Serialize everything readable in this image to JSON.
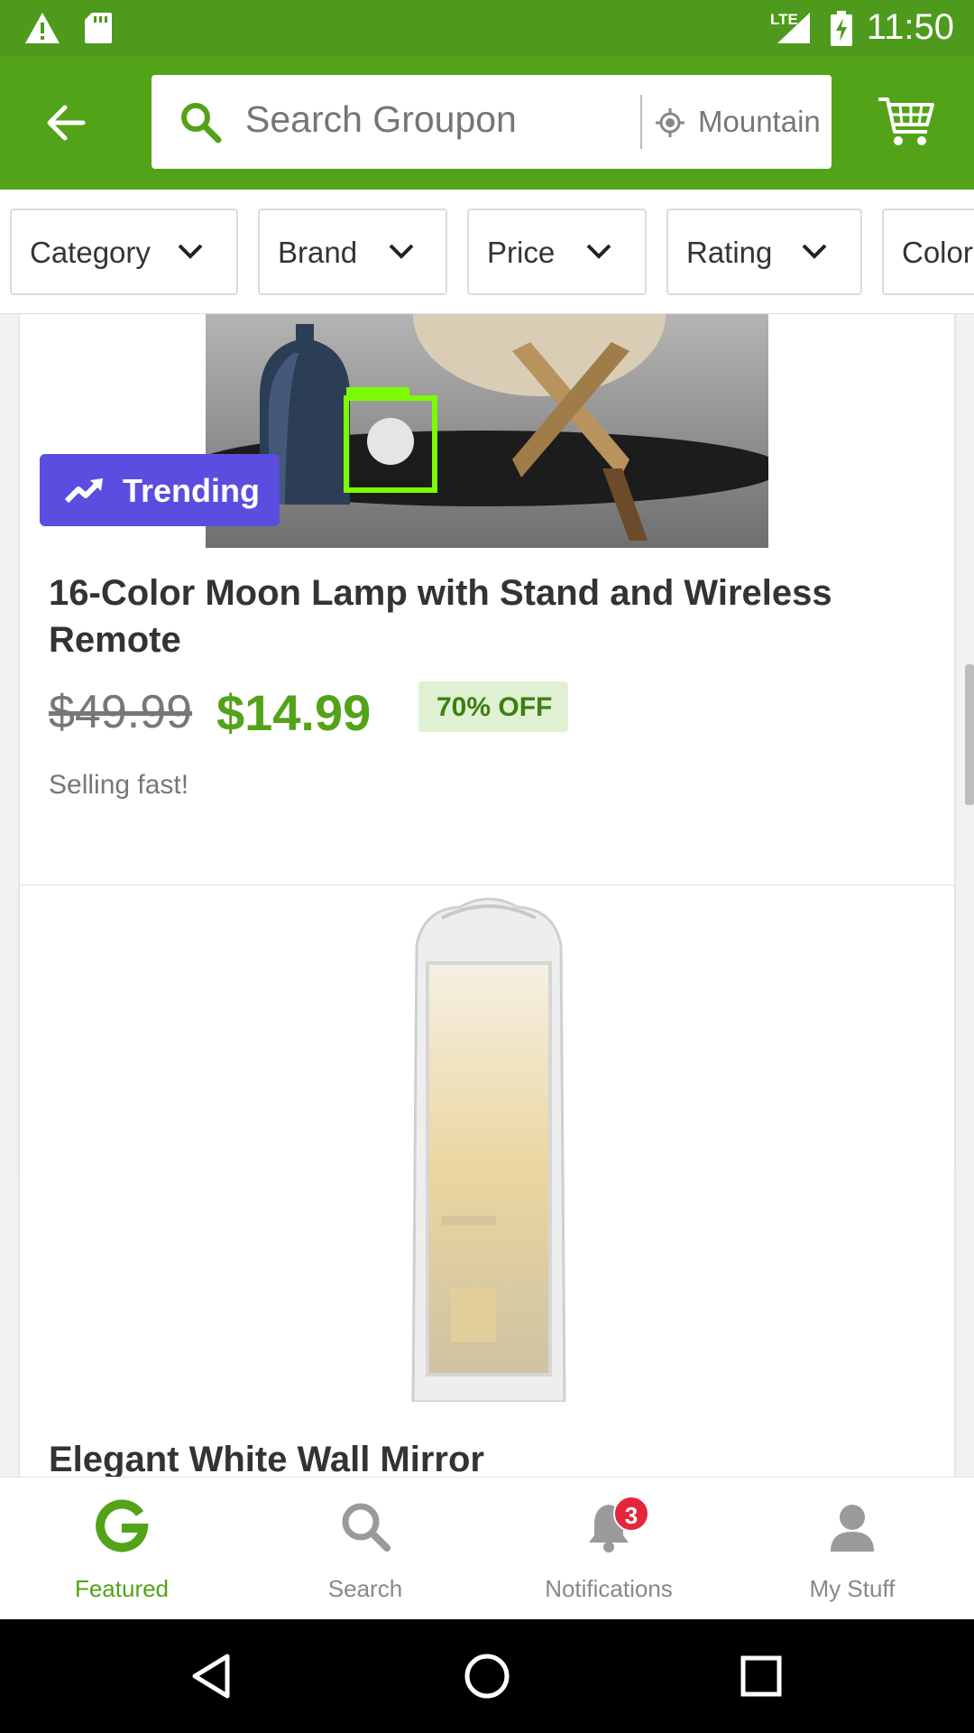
{
  "status_bar": {
    "time": "11:50",
    "network_label": "LTE",
    "icons": [
      "alert-icon",
      "sd-card-icon",
      "signal-icon",
      "battery-charging-icon"
    ]
  },
  "app_bar": {
    "search_placeholder": "Search Groupon",
    "location": "Mountain",
    "icons": [
      "back-arrow-icon",
      "search-icon",
      "location-icon",
      "cart-icon"
    ]
  },
  "filters": [
    {
      "label": "Category"
    },
    {
      "label": "Brand"
    },
    {
      "label": "Price"
    },
    {
      "label": "Rating"
    },
    {
      "label": "Color"
    }
  ],
  "deals": [
    {
      "badge": "Trending",
      "title": "16-Color Moon Lamp with Stand and Wireless Remote",
      "original_price": "$49.99",
      "price": "$14.99",
      "discount": "70% OFF",
      "urgency": "Selling fast!"
    },
    {
      "title": "Elegant White Wall Mirror"
    }
  ],
  "bottom_nav": {
    "items": [
      {
        "label": "Featured",
        "icon": "groupon-g-icon",
        "active": true
      },
      {
        "label": "Search",
        "icon": "search-icon",
        "active": false
      },
      {
        "label": "Notifications",
        "icon": "bell-icon",
        "active": false,
        "badge": "3"
      },
      {
        "label": "My Stuff",
        "icon": "person-icon",
        "active": false
      }
    ]
  },
  "colors": {
    "brand_green": "#53a318",
    "status_green": "#4e9a1c",
    "trending_purple": "#5b4de0",
    "discount_bg": "#dff0d3",
    "badge_red": "#e5253a"
  }
}
